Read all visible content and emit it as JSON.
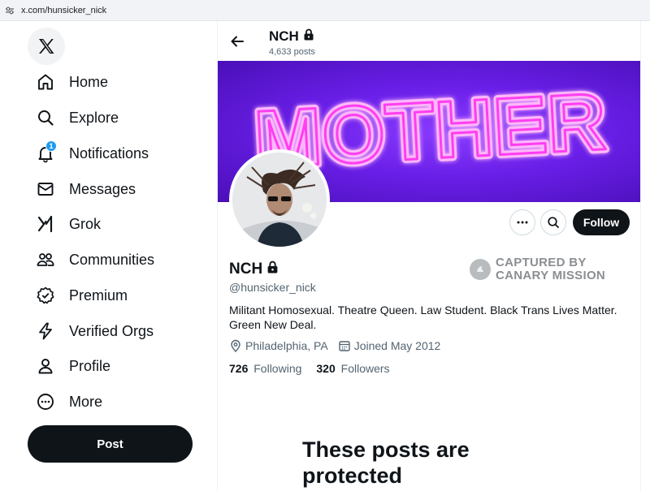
{
  "browser": {
    "url": "x.com/hunsicker_nick"
  },
  "nav": {
    "items": [
      {
        "label": "Home",
        "icon": "home-icon"
      },
      {
        "label": "Explore",
        "icon": "search-icon"
      },
      {
        "label": "Notifications",
        "icon": "bell-icon",
        "badge": "1"
      },
      {
        "label": "Messages",
        "icon": "envelope-icon"
      },
      {
        "label": "Grok",
        "icon": "grok-icon"
      },
      {
        "label": "Communities",
        "icon": "people-icon"
      },
      {
        "label": "Premium",
        "icon": "verified-badge-icon"
      },
      {
        "label": "Verified Orgs",
        "icon": "lightning-icon"
      },
      {
        "label": "Profile",
        "icon": "person-icon"
      },
      {
        "label": "More",
        "icon": "more-circle-icon"
      }
    ],
    "post_label": "Post"
  },
  "header": {
    "name": "NCH",
    "posts": "4,633 posts"
  },
  "banner": {
    "text": "MOTHER",
    "accent": "#ff4df2",
    "bg": "#6a1fe8"
  },
  "profile": {
    "name": "NCH",
    "handle": "@hunsicker_nick",
    "bio": "Militant Homosexual. Theatre Queen. Law Student. Black Trans Lives Matter. Green New Deal.",
    "location": "Philadelphia, PA",
    "joined": "Joined May 2012",
    "following_count": "726",
    "following_label": "Following",
    "followers_count": "320",
    "followers_label": "Followers",
    "follow_label": "Follow"
  },
  "stamp": {
    "line1": "CAPTURED BY",
    "line2": "CANARY MISSION"
  },
  "protected_msg": "These posts are protected"
}
